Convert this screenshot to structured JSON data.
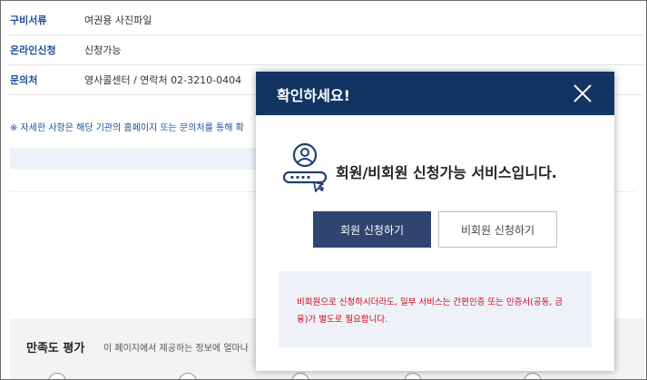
{
  "info_table": [
    {
      "label": "구비서류",
      "value": "여권용 사진파일"
    },
    {
      "label": "온라인신청",
      "value": "신청가능"
    },
    {
      "label": "문의처",
      "value": "영사콜센터 / 연락처 02-3210-0404"
    }
  ],
  "note": "※ 자세한 사항은 해당 기관의 홈페이지 또는 문의처를 통해 확",
  "rating": {
    "title": "만족도 평가",
    "description": "이 페이지에서 제공하는 정보에 얼마나"
  },
  "modal": {
    "title": "확인하세요!",
    "close_icon": "close-icon",
    "message": "회원/비회원 신청가능 서비스입니다.",
    "member_button": "회원 신청하기",
    "guest_button": "비회원 신청하기",
    "notice": "비회원으로 신청하시더라도, 일부 서비스는 간편인증 또는 인증서(공동, 금융)가 별도로 필요합니다."
  },
  "colors": {
    "header": "#123462",
    "primary_button": "#2f4570",
    "notice_text": "#d0021b",
    "label_text": "#1d4f99"
  }
}
